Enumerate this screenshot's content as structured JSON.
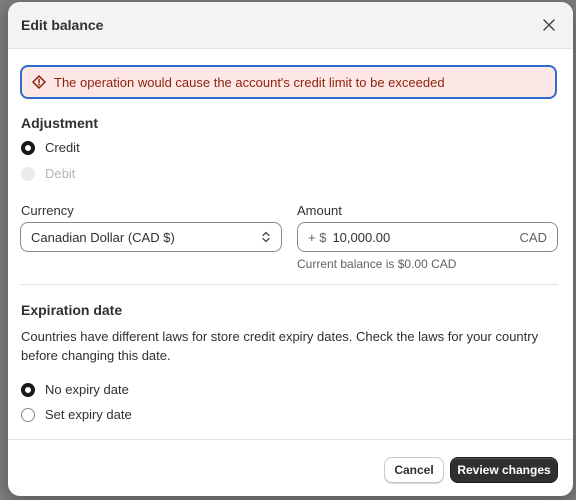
{
  "modal": {
    "title": "Edit balance",
    "close_icon": "close-icon"
  },
  "alert": {
    "icon": "warning-diamond-icon",
    "message": "The operation would cause the account's credit limit to be exceeded"
  },
  "adjustment": {
    "title": "Adjustment",
    "options": [
      {
        "label": "Credit",
        "selected": true,
        "disabled": false
      },
      {
        "label": "Debit",
        "selected": false,
        "disabled": true
      }
    ]
  },
  "currency": {
    "label": "Currency",
    "value": "Canadian Dollar (CAD $)",
    "icon": "select-chevrons-icon"
  },
  "amount": {
    "label": "Amount",
    "prefix": "+ $",
    "value": "10,000.00",
    "suffix": "CAD",
    "help": "Current balance is $0.00 CAD"
  },
  "expiration": {
    "title": "Expiration date",
    "description": "Countries have different laws for store credit expiry dates. Check the laws for your country before changing this date.",
    "options": [
      {
        "label": "No expiry date",
        "selected": true
      },
      {
        "label": "Set expiry date",
        "selected": false
      }
    ]
  },
  "footer": {
    "cancel_label": "Cancel",
    "primary_label": "Review changes"
  },
  "colors": {
    "alert_bg": "#fde8e6",
    "alert_border": "#2c6ecb",
    "alert_text": "#8e1f0b",
    "primary_button": "#303030"
  }
}
